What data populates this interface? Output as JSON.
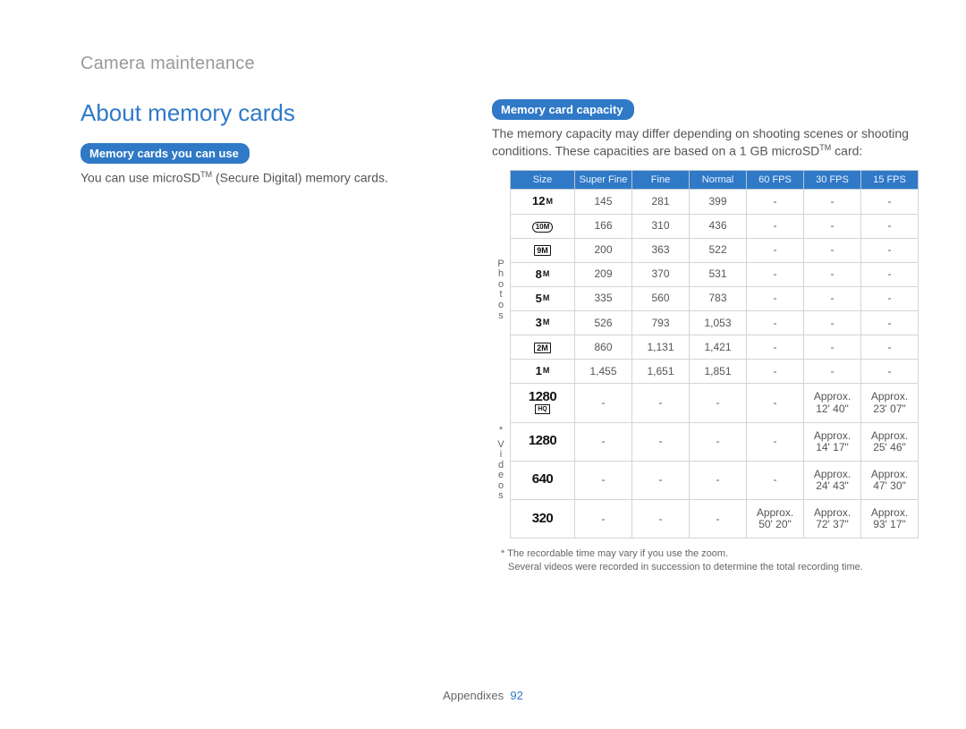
{
  "breadcrumb": "Camera maintenance",
  "heading": "About memory cards",
  "left": {
    "pill": "Memory cards you can use",
    "body_prefix": "You can use microSD",
    "body_tm": "TM",
    "body_suffix": " (Secure Digital) memory cards."
  },
  "right": {
    "pill": "Memory card capacity",
    "body_prefix": "The memory capacity may differ depending on shooting scenes or shooting conditions. These capacities are based on a 1 GB microSD",
    "body_tm": "TM",
    "body_suffix": " card:"
  },
  "table": {
    "headers": {
      "size": "Size",
      "sf": "Super Fine",
      "f": "Fine",
      "n": "Normal",
      "f60": "60 FPS",
      "f30": "30 FPS",
      "f15": "15 FPS"
    },
    "side_photos": "Photos",
    "side_videos_star": "*",
    "side_videos": "Videos",
    "photo_sizes": [
      {
        "style": "bold",
        "num": "12",
        "suf": "M"
      },
      {
        "style": "wide",
        "num": "10M",
        "suf": ""
      },
      {
        "style": "box",
        "num": "9M",
        "suf": ""
      },
      {
        "style": "bold",
        "num": "8",
        "suf": "M"
      },
      {
        "style": "bold",
        "num": "5",
        "suf": "M"
      },
      {
        "style": "bold",
        "num": "3",
        "suf": "M"
      },
      {
        "style": "box",
        "num": "2M",
        "suf": ""
      },
      {
        "style": "bold",
        "num": "1",
        "suf": "M"
      }
    ],
    "photo_rows": [
      {
        "sf": "145",
        "f": "281",
        "n": "399"
      },
      {
        "sf": "166",
        "f": "310",
        "n": "436"
      },
      {
        "sf": "200",
        "f": "363",
        "n": "522"
      },
      {
        "sf": "209",
        "f": "370",
        "n": "531"
      },
      {
        "sf": "335",
        "f": "560",
        "n": "783"
      },
      {
        "sf": "526",
        "f": "793",
        "n": "1,053"
      },
      {
        "sf": "860",
        "f": "1,131",
        "n": "1,421"
      },
      {
        "sf": "1,455",
        "f": "1,651",
        "n": "1,851"
      }
    ],
    "dash": "-",
    "video_sizes": [
      {
        "num": "1280",
        "hq": "HQ"
      },
      {
        "num": "1280",
        "hq": ""
      },
      {
        "num": "640",
        "hq": ""
      },
      {
        "num": "320",
        "hq": ""
      }
    ],
    "video_rows": [
      {
        "f60": "-",
        "f30": "Approx. 12' 40\"",
        "f15": "Approx. 23' 07\""
      },
      {
        "f60": "-",
        "f30": "Approx. 14' 17\"",
        "f15": "Approx. 25' 46\""
      },
      {
        "f60": "-",
        "f30": "Approx. 24' 43\"",
        "f15": "Approx. 47' 30\""
      },
      {
        "f60": "Approx. 50' 20\"",
        "f30": "Approx. 72' 37\"",
        "f15": "Approx. 93' 17\""
      }
    ]
  },
  "notes": {
    "n1": "* The recordable time may vary if you use the zoom.",
    "n2": "Several videos were recorded in succession to determine the total recording time."
  },
  "footer": {
    "section": "Appendixes",
    "page": "92"
  },
  "chart_data": {
    "type": "table",
    "title": "Memory card capacity (1 GB microSD)",
    "photos": {
      "columns": [
        "Size",
        "Super Fine",
        "Fine",
        "Normal"
      ],
      "rows": [
        [
          "12M",
          145,
          281,
          399
        ],
        [
          "10M (wide)",
          166,
          310,
          436
        ],
        [
          "9M",
          200,
          363,
          522
        ],
        [
          "8M",
          209,
          370,
          531
        ],
        [
          "5M",
          335,
          560,
          783
        ],
        [
          "3M",
          526,
          793,
          1053
        ],
        [
          "2M",
          860,
          1131,
          1421
        ],
        [
          "1M",
          1455,
          1651,
          1851
        ]
      ]
    },
    "videos": {
      "columns": [
        "Size",
        "60 FPS",
        "30 FPS",
        "15 FPS"
      ],
      "rows": [
        [
          "1280 HQ",
          null,
          "Approx. 12' 40\"",
          "Approx. 23' 07\""
        ],
        [
          "1280",
          null,
          "Approx. 14' 17\"",
          "Approx. 25' 46\""
        ],
        [
          "640",
          null,
          "Approx. 24' 43\"",
          "Approx. 47' 30\""
        ],
        [
          "320",
          "Approx. 50' 20\"",
          "Approx. 72' 37\"",
          "Approx. 93' 17\""
        ]
      ]
    }
  }
}
